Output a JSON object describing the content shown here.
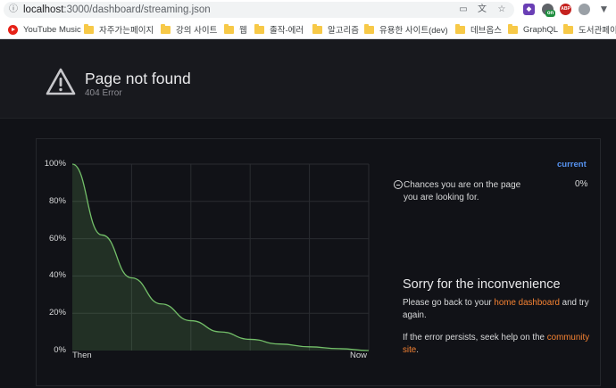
{
  "browser": {
    "url_host": "localhost",
    "url_path": ":3000/dashboard/streaming.json",
    "bookmarks": [
      {
        "label": "YouTube Music",
        "icon": "youtube-icon"
      },
      {
        "label": "자주가는페이지",
        "icon": "folder-icon"
      },
      {
        "label": "강의 사이트",
        "icon": "folder-icon"
      },
      {
        "label": "웹",
        "icon": "folder-icon"
      },
      {
        "label": "졸작-에러",
        "icon": "folder-icon"
      },
      {
        "label": "알고리즘",
        "icon": "folder-icon"
      },
      {
        "label": "유용한 사이트(dev)",
        "icon": "folder-icon"
      },
      {
        "label": "데브옵스",
        "icon": "folder-icon"
      },
      {
        "label": "GraphQL",
        "icon": "folder-icon"
      },
      {
        "label": "도서관페이지",
        "icon": "folder-icon"
      }
    ],
    "extensions": {
      "on_badge": "on",
      "abp_badge": "ABP"
    }
  },
  "header": {
    "title": "Page not found",
    "subtitle": "404 Error"
  },
  "chart_data": {
    "type": "area",
    "x_tick_labels": [
      "Then",
      "Now"
    ],
    "y_tick_labels": [
      "0%",
      "20%",
      "40%",
      "60%",
      "80%",
      "100%"
    ],
    "ylim": [
      0,
      100
    ],
    "grid": true,
    "color": "#73bf69",
    "series": [
      {
        "name": "Chances you are on the page you are looking for.",
        "x": [
          0,
          0.1,
          0.2,
          0.3,
          0.4,
          0.5,
          0.6,
          0.7,
          0.8,
          0.9,
          1.0
        ],
        "values": [
          100,
          62,
          39,
          25,
          16,
          10,
          6,
          3.5,
          2,
          1,
          0
        ]
      }
    ]
  },
  "legend": {
    "header": "current",
    "label": "Chances you are on the page you are looking for.",
    "value": "0%"
  },
  "message": {
    "title": "Sorry for the inconvenience",
    "p1_before": "Please go back to your ",
    "p1_link": "home dashboard",
    "p1_after": " and try again.",
    "p2_before": "If the error persists, seek help on the ",
    "p2_link": "community site",
    "p2_after": "."
  }
}
